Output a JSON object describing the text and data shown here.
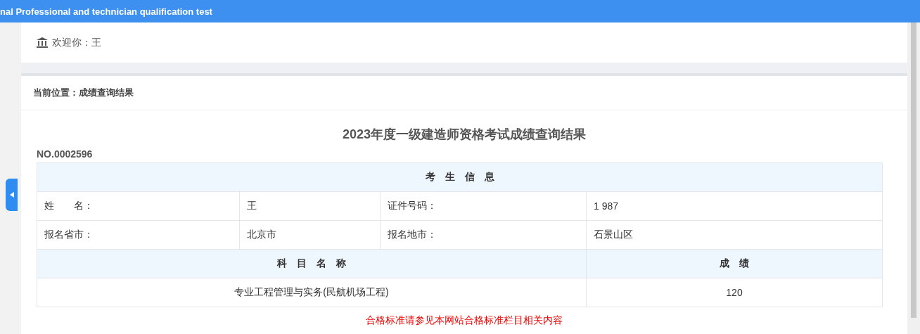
{
  "header": {
    "title": "nal Professional and technician qualification test"
  },
  "welcome": {
    "text": "欢迎你：王"
  },
  "breadcrumb": "当前位置：成绩查询结果",
  "result": {
    "title": "2023年度一级建造师资格考试成绩查询结果",
    "number": "NO.0002596",
    "info_heading": "考　生　信　息",
    "info_rows": [
      [
        "姓　　名：",
        "王",
        "证件号码：",
        "1 987"
      ],
      [
        "报名省市：",
        "北京市",
        "报名地市：",
        "石景山区"
      ]
    ],
    "subject_heading": "科　目　名　称",
    "score_heading": "成　绩",
    "subjects": [
      {
        "name": "专业工程管理与实务(民航机场工程)",
        "score": "120"
      }
    ]
  },
  "notice": "合格标准请参见本网站合格标准栏目相关内容"
}
